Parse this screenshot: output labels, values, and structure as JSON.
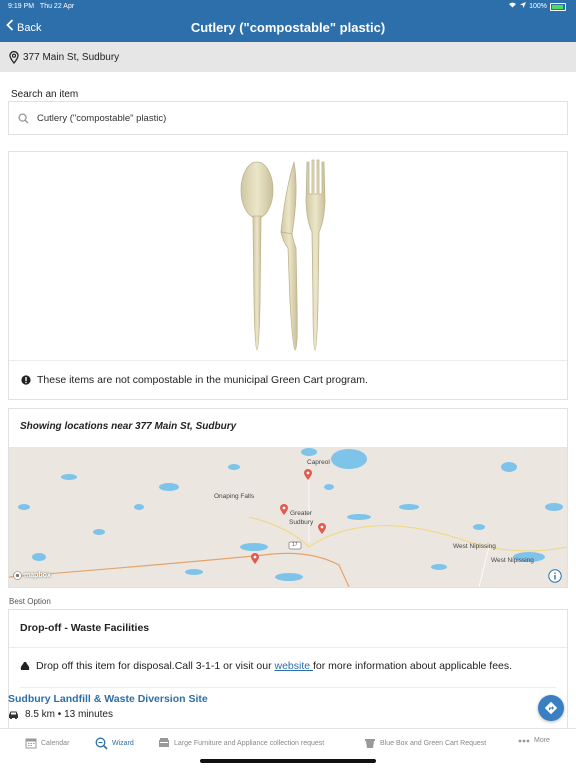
{
  "status": {
    "time": "9:19 PM",
    "date": "Thu 22 Apr",
    "battery": "100%"
  },
  "nav": {
    "back_label": "Back",
    "title": "Cutlery (\"compostable\" plastic)"
  },
  "address": {
    "text": "377 Main St, Sudbury"
  },
  "search": {
    "label": "Search an item",
    "value": "Cutlery (\"compostable\" plastic)"
  },
  "item": {
    "notice": "These items are not compostable in the municipal Green Cart program."
  },
  "locations": {
    "header": "Showing locations near 377 Main St, Sudbury",
    "map_labels": {
      "capreol": "Capreol",
      "onaping": "Onaping Falls",
      "greater": "Greater",
      "sudbury": "Sudbury",
      "west_nipissing_1": "West Nipissing",
      "west_nipissing_2": "West Nipissing",
      "highway": "17",
      "mapbox": "mapbox"
    }
  },
  "best_option": {
    "label": "Best Option",
    "title": "Drop-off - Waste Facilities",
    "text_before": "Drop off this item for disposal.Call 3-1-1 or visit our ",
    "link": "website ",
    "text_after": "for more information about applicable fees.",
    "site_name": "Sudbury Landfill & Waste Diversion Site",
    "distance": "8.5 km • 13 minutes"
  },
  "tabs": [
    {
      "label": "Calendar",
      "icon": "calendar-icon"
    },
    {
      "label": "Wizard",
      "icon": "wizard-search-icon"
    },
    {
      "label": "Large Furniture and Appliance collection request",
      "icon": "furniture-icon"
    },
    {
      "label": "Blue Box and Green Cart Request",
      "icon": "bin-icon"
    },
    {
      "label": "More",
      "icon": "more-icon"
    }
  ],
  "colors": {
    "primary": "#2d6faa",
    "link": "#2d6faa",
    "map_water": "#7ec3ea",
    "map_land": "#ebe7e0",
    "pin": "#e05a4f"
  }
}
